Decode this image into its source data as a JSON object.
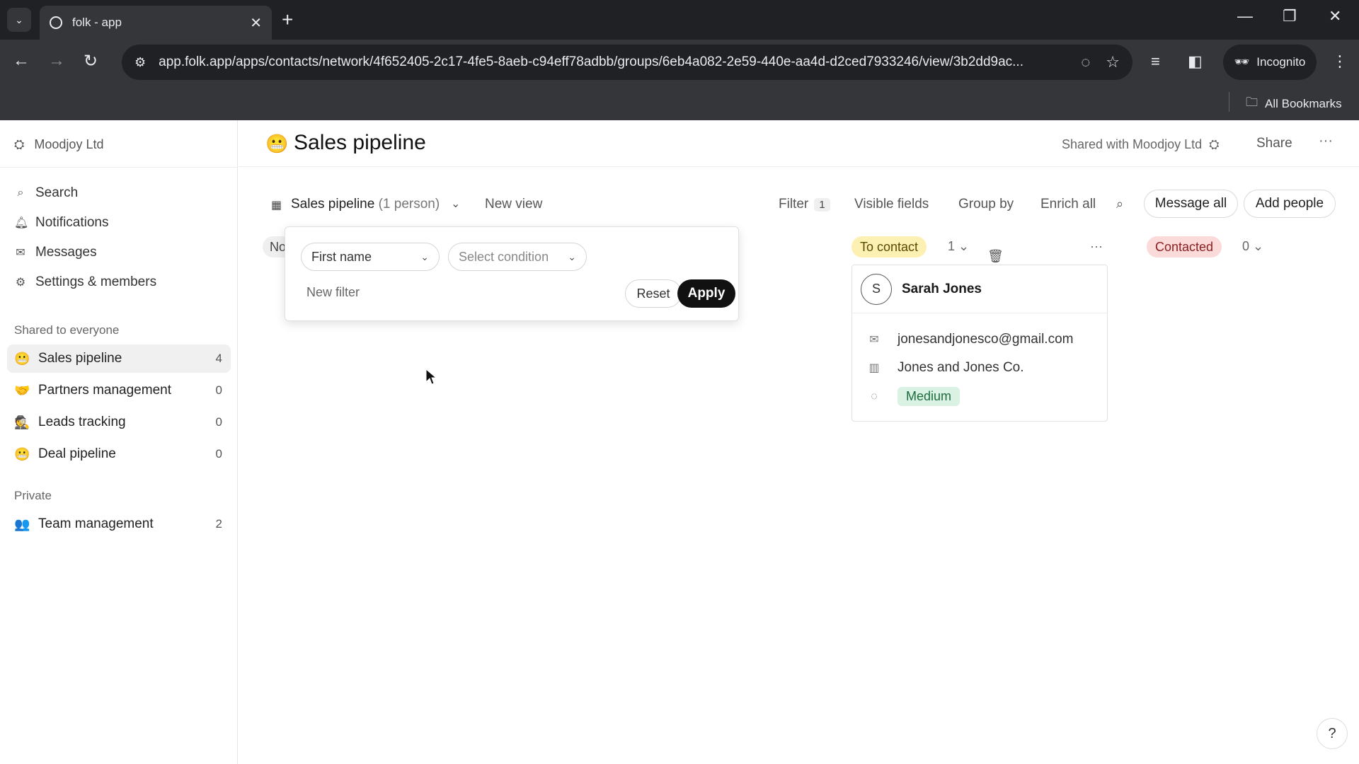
{
  "browser": {
    "tab_title": "folk - app",
    "url": "app.folk.app/apps/contacts/network/4f652405-2c17-4fe5-8aeb-c94eff78adbb/groups/6eb4a082-2e59-440e-aa4d-d2ced7933246/view/3b2dd9ac...",
    "incognito_label": "Incognito",
    "bookmarks_label": "All Bookmarks"
  },
  "sidebar": {
    "workspace": "Moodjoy Ltd",
    "nav": [
      {
        "label": "Search",
        "icon": "search-icon"
      },
      {
        "label": "Notifications",
        "icon": "bell-icon"
      },
      {
        "label": "Messages",
        "icon": "mail-icon"
      },
      {
        "label": "Settings & members",
        "icon": "gear-icon"
      }
    ],
    "shared_heading": "Shared to everyone",
    "shared_groups": [
      {
        "emoji": "😬",
        "name": "Sales pipeline",
        "count": "4"
      },
      {
        "emoji": "🤝",
        "name": "Partners management",
        "count": "0"
      },
      {
        "emoji": "🕵",
        "name": "Leads tracking",
        "count": "0"
      },
      {
        "emoji": "😬",
        "name": "Deal pipeline",
        "count": "0"
      }
    ],
    "private_heading": "Private",
    "private_groups": [
      {
        "emoji": "👥",
        "name": "Team management",
        "count": "2"
      }
    ]
  },
  "header": {
    "emoji": "😬",
    "title": "Sales pipeline",
    "shared_text": "Shared with Moodjoy Ltd",
    "share_label": "Share",
    "more_label": "···"
  },
  "viewbar": {
    "view_name": "Sales pipeline",
    "view_count": "(1 person)",
    "new_view": "New view",
    "filter": "Filter",
    "filter_count": "1",
    "visible_fields": "Visible fields",
    "group_by": "Group by",
    "enrich_all": "Enrich all",
    "message_all": "Message all",
    "add_people": "Add people"
  },
  "filter_popover": {
    "field": "First name",
    "condition_placeholder": "Select condition",
    "new_filter": "New filter",
    "reset": "Reset",
    "apply": "Apply"
  },
  "board": {
    "hidden_column_label": "No",
    "columns": [
      {
        "name": "To contact",
        "count": "1",
        "color": "#fdf0b3",
        "text_color": "#5a4a00"
      },
      {
        "name": "Contacted",
        "count": "0",
        "color": "#fbdada",
        "text_color": "#8a1f1f"
      }
    ],
    "card": {
      "initial": "S",
      "name": "Sarah Jones",
      "email": "jonesandjonesco@gmail.com",
      "company": "Jones and Jones Co.",
      "priority": "Medium"
    }
  },
  "help_label": "?"
}
